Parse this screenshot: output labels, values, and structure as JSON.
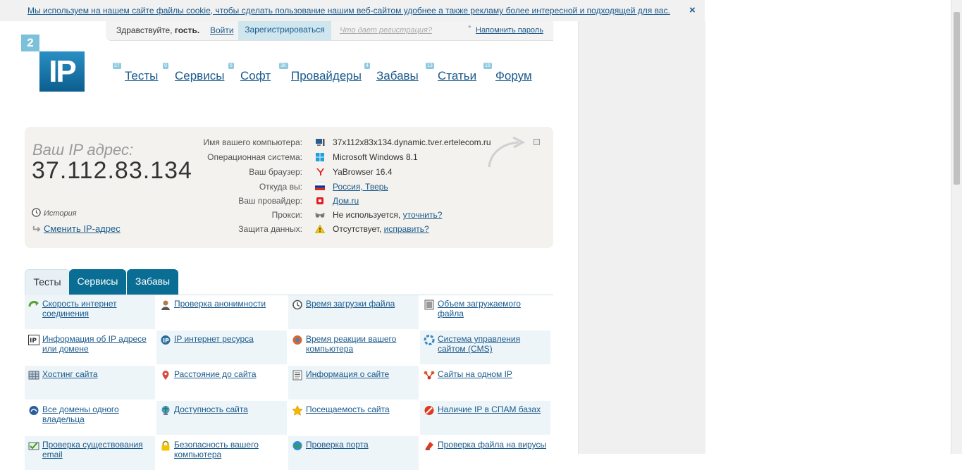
{
  "cookie": {
    "text": "Мы используем на нашем сайте файлы cookie, чтобы сделать пользование нашим веб-сайтом удобнее а также рекламу более интересной и подходящей для вас.",
    "close": "×"
  },
  "login_bar": {
    "greeting": "Здравствуйте,",
    "guest": "гость.",
    "login": "Войти",
    "register": "Зарегистрироваться",
    "what_gives": "Что дает регистрация?",
    "star": "*",
    "remind": "Напомнить пароль"
  },
  "logo": {
    "small": "2",
    "big": "IP"
  },
  "nav": [
    {
      "label": "Тесты",
      "count": "27"
    },
    {
      "label": "Сервисы",
      "count": "9"
    },
    {
      "label": "Софт",
      "count": "5"
    },
    {
      "label": "Провайдеры",
      "count": "3K"
    },
    {
      "label": "Забавы",
      "count": "4"
    },
    {
      "label": "Статьи",
      "count": "13"
    },
    {
      "label": "Форум",
      "count": "15"
    }
  ],
  "ipbox": {
    "label": "Ваш IP адрес:",
    "ip": "37.112.83.134",
    "history": "История",
    "change_ip": "Сменить IP-адрес",
    "rows": [
      {
        "key": "Имя вашего компьютера:",
        "value": "37x112x83x134.dynamic.tver.ertelecom.ru",
        "icon": "computer-icon"
      },
      {
        "key": "Операционная система:",
        "value": "Microsoft Windows 8.1",
        "icon": "windows-icon"
      },
      {
        "key": "Ваш браузер:",
        "value": "YaBrowser 16.4",
        "icon": "yandex-browser-icon"
      },
      {
        "key": "Откуда вы:",
        "value": "Россия, Тверь",
        "icon": "russia-flag-icon"
      },
      {
        "key": "Ваш провайдер:",
        "value": "Дом.ru",
        "icon": "provider-icon"
      },
      {
        "key": "Прокси:",
        "value": "Не используется,",
        "link": "уточнить?",
        "icon": "glasses-icon"
      },
      {
        "key": "Защита данных:",
        "value": "Отсутствует,",
        "link": "исправить?",
        "icon": "warning-icon"
      }
    ]
  },
  "tabs": [
    {
      "label": "Тесты"
    },
    {
      "label": "Сервисы"
    },
    {
      "label": "Забавы"
    }
  ],
  "tests": [
    [
      "Скорость интернет соединения",
      "Проверка анонимности",
      "Время загрузки файла",
      "Объем загружаемого файла"
    ],
    [
      "Информация об IP адресе или домене",
      "IP интернет ресурса",
      "Время реакции вашего компьютера",
      "Система управления сайтом (CMS)"
    ],
    [
      "Хостинг сайта",
      "Расстояние до сайта",
      "Информация о сайте",
      "Сайты на одном IP"
    ],
    [
      "Все домены одного владельца",
      "Доступность сайта",
      "Посещаемость сайта",
      "Наличие IP в СПАМ базах"
    ],
    [
      "Проверка существования email",
      "Безопасность вашего компьютера",
      "Проверка порта",
      "Проверка файла на вирусы"
    ]
  ],
  "colors": {
    "accent": "#1a5a8c",
    "tab_dark": "#0a6d93",
    "logo_blue": "#2a8fc3",
    "box_bg": "#f4f2ee"
  }
}
